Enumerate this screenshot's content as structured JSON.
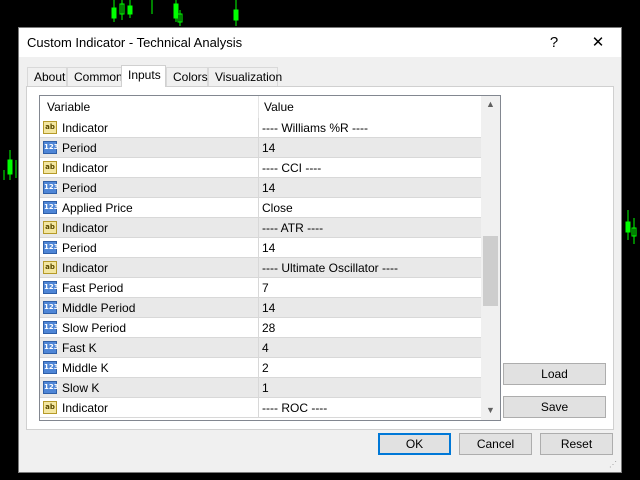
{
  "window": {
    "title": "Custom Indicator - Technical Analysis",
    "help_glyph": "?",
    "close_glyph": "✕"
  },
  "tabs": [
    {
      "label": "About"
    },
    {
      "label": "Common"
    },
    {
      "label": "Inputs",
      "active": true
    },
    {
      "label": "Colors"
    },
    {
      "label": "Visualization"
    }
  ],
  "grid": {
    "header_variable": "Variable",
    "header_value": "Value",
    "rows": [
      {
        "type": "string",
        "variable": "Indicator",
        "value": "---- Williams %R ----"
      },
      {
        "type": "number",
        "variable": "Period",
        "value": "14"
      },
      {
        "type": "string",
        "variable": "Indicator",
        "value": "---- CCI ----"
      },
      {
        "type": "number",
        "variable": "Period",
        "value": "14"
      },
      {
        "type": "number",
        "variable": "Applied Price",
        "value": "Close"
      },
      {
        "type": "string",
        "variable": "Indicator",
        "value": "---- ATR ----"
      },
      {
        "type": "number",
        "variable": "Period",
        "value": "14"
      },
      {
        "type": "string",
        "variable": "Indicator",
        "value": "---- Ultimate Oscillator ----"
      },
      {
        "type": "number",
        "variable": "Fast Period",
        "value": "7"
      },
      {
        "type": "number",
        "variable": "Middle Period",
        "value": "14"
      },
      {
        "type": "number",
        "variable": "Slow Period",
        "value": "28"
      },
      {
        "type": "number",
        "variable": "Fast K",
        "value": "4"
      },
      {
        "type": "number",
        "variable": "Middle K",
        "value": "2"
      },
      {
        "type": "number",
        "variable": "Slow K",
        "value": "1"
      },
      {
        "type": "string",
        "variable": "Indicator",
        "value": "---- ROC ----"
      }
    ],
    "icon_text_number": "123",
    "icon_text_string": "ab"
  },
  "side_buttons": {
    "load": "Load",
    "save": "Save"
  },
  "footer": {
    "ok": "OK",
    "cancel": "Cancel",
    "reset": "Reset"
  },
  "colors": {
    "background": "#000000",
    "candle": "#00ff00",
    "dialog": "#f0f0f0",
    "accent": "#0078d7"
  }
}
